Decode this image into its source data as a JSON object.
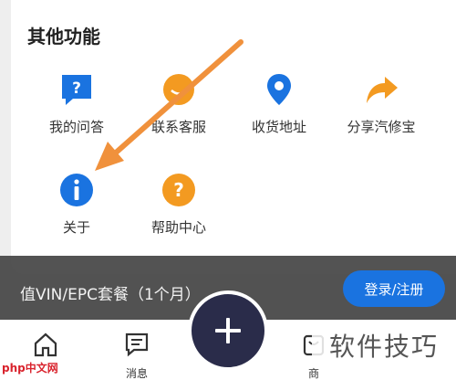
{
  "section": {
    "title": "其他功能"
  },
  "features": [
    {
      "label": "我的问答",
      "icon": "qa-icon"
    },
    {
      "label": "联系客服",
      "icon": "customer-service-icon"
    },
    {
      "label": "收货地址",
      "icon": "location-pin-icon"
    },
    {
      "label": "分享汽修宝",
      "icon": "share-icon"
    },
    {
      "label": "关于",
      "icon": "info-icon"
    },
    {
      "label": "帮助中心",
      "icon": "help-icon"
    }
  ],
  "promo": {
    "text": "值VIN/EPC套餐（1个月）",
    "button": "登录/注册"
  },
  "tabbar": {
    "home": "",
    "messages": "消息",
    "shop": "商"
  },
  "watermarks": {
    "right": "软件技巧",
    "left": "php中文网"
  },
  "colors": {
    "blue": "#1a73e0",
    "orange": "#f39a21",
    "arrow": "#f0913c",
    "fab": "#2a2c4a"
  }
}
